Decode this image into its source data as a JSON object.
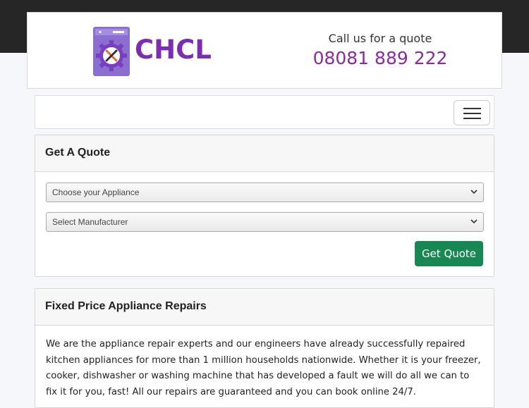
{
  "brand": {
    "name": "CHCL"
  },
  "contact": {
    "label": "Call us for a quote",
    "phone": "08081 889 222"
  },
  "quote_card": {
    "title": "Get A Quote",
    "appliance_select": "Choose your Appliance",
    "manufacturer_select": "Select Manufacturer",
    "button": "Get Quote"
  },
  "repairs_card": {
    "title": "Fixed Price Appliance Repairs",
    "text": "We are the appliance repair experts and our engineers have already successfully repaired kitchen appliances for more than 1 million households nationwide. Whether it is your freezer, cooker, dishwasher or washing machine that has developed a fault we will do all we can to fix it for you, fast! All our repairs are guaranteed and you can book online 24/7."
  },
  "colors": {
    "brand": "#7b2fb0",
    "phone": "#8a2a9e",
    "button": "#198754"
  },
  "icons": {
    "logo": "washing-machine-gear-tools-icon",
    "menu": "hamburger-menu-icon",
    "select_arrow": "chevron-down-icon"
  }
}
